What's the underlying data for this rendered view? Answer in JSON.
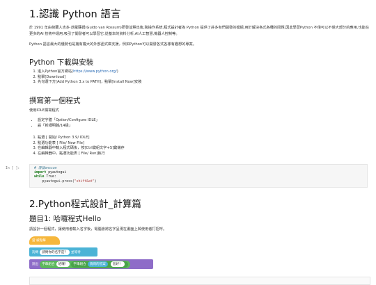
{
  "heading1": "1.認識 Python 語言",
  "intro_para": "於 1991 年由荷蘭人吉多·范羅蘇姆(Guido van Rossum)研發並釋出後,跨操作系統,程式設計者為 Python 提供了許多有們開發的模組,用於解決各式各種的問題,因此學習Python 不僅可以不僅大部分的應用,也能在更多的AI 技術中運用,吸引了開發者可以學習它,從基本的資料分析,AI人工智慧,機器人控制等。",
  "intro_para2": "Python 語言最大的優勢也是擁有龐大的外部函式庫支援，例如Python可以開發各式各樣有趣想的專案。",
  "download": {
    "title": "Python 下載與安裝",
    "steps": [
      {
        "pre": "進入Python官方網站(",
        "link": "https://www.python.org/",
        "post": ")"
      },
      {
        "pre": "點擊[Download]",
        "link": "",
        "post": ""
      },
      {
        "pre": "先勾選下方[Add Python 3.x to PATH]，點擊[Install Now]安裝",
        "link": "",
        "post": ""
      }
    ]
  },
  "first_program": {
    "title": "撰寫第一個程式",
    "intro": "使用IDLE撰寫程式",
    "bullets": [
      "設定字體「Option/Configure IDLE」",
      "設「新細明體/14級」"
    ],
    "steps": [
      "點選 [ 開始/ Python 3.9/ IDLE]",
      "點選功能表 [ File/ New File]",
      "在編輯器中輸入程式碼後，按[Ctrl鍵組文字+S]鍵儲存",
      "在編輯器中，點選功能表 [ File/ Run]執行"
    ]
  },
  "code_cell": {
    "prompt": "In [ ]:",
    "comment": "# 滑鼠onscan",
    "line2_kw": "import",
    "line2_rest": " pyautogui",
    "line3_kw": "while",
    "line3_rest": " True:",
    "line4_fn": "    pyautogui.press(",
    "line4_str": "\"shift&at\"",
    "line4_end": ")"
  },
  "heading2": "2.Python程式設計_計算篇",
  "topic": {
    "title": "題目1: 哈囉程式Hello",
    "desc": "請設計一個程式，讓使用者輸入名字後，電腦會將名字呈現在畫面上與使用者打招呼。"
  },
  "blocks": {
    "hat": "當 被點擊",
    "ask_label": "詢問",
    "ask_text": "請問你的名字是？",
    "ask_wait": "並等待",
    "say_label": "說出",
    "join1": "字串組合",
    "hello": "哈囉！",
    "join2": "字串組合",
    "answer": "詢問的答案",
    "nice": "您好！",
    "colors": {
      "event": "#f6b73c",
      "sense": "#4bb3d6",
      "looks": "#8e6cc8",
      "ops": "#5cb85c"
    }
  }
}
